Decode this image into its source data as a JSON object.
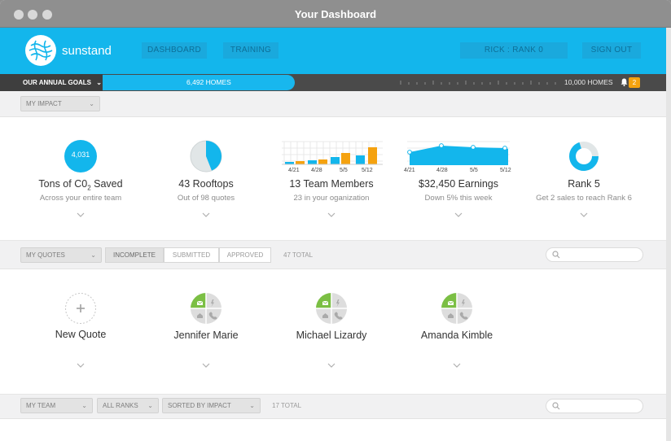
{
  "window": {
    "title": "Your Dashboard"
  },
  "header": {
    "brand": "sunstand",
    "nav": {
      "dashboard": "DASHBOARD",
      "training": "TRAINING",
      "rank": "RICK : RANK 0",
      "signout": "SIGN OUT"
    }
  },
  "goals": {
    "label": "OUR ANNUAL GOALS",
    "current": "6,492 HOMES",
    "max": "10,000 HOMES",
    "progress": 0.6492,
    "notifications": "2"
  },
  "impact": {
    "filter": "MY IMPACT",
    "stats": [
      {
        "value": "4,031",
        "title_main": "Tons of C0",
        "title_sub": "2",
        "title_end": " Saved",
        "subtitle": "Across your entire team"
      },
      {
        "title": "43 Rooftops",
        "subtitle": "Out of 98 quotes",
        "pie_fraction": 0.44
      },
      {
        "title": "13 Team Members",
        "subtitle": "23 in your oganization",
        "dates": [
          "4/21",
          "4/28",
          "5/5",
          "5/12"
        ]
      },
      {
        "title": "$32,450 Earnings",
        "subtitle": "Down 5% this week",
        "dates": [
          "4/21",
          "4/28",
          "5/5",
          "5/12"
        ]
      },
      {
        "title": "Rank 5",
        "subtitle": "Get 2 sales to reach Rank 6",
        "ring_fraction": 0.7
      }
    ]
  },
  "quotes": {
    "filter": "MY QUOTES",
    "tabs": [
      "INCOMPLETE",
      "SUBMITTED",
      "APPROVED"
    ],
    "total": "47 TOTAL",
    "search_placeholder": "",
    "new_quote": "New Quote",
    "items": [
      "Jennifer Marie",
      "Michael Lizardy",
      "Amanda Kimble"
    ]
  },
  "team": {
    "filter": "MY TEAM",
    "ranks": "ALL RANKS",
    "sort": "SORTED BY IMPACT",
    "total": "17 TOTAL"
  },
  "colors": {
    "accent": "#13b6ec",
    "orange": "#f5a20f",
    "green": "#7bbf44"
  }
}
